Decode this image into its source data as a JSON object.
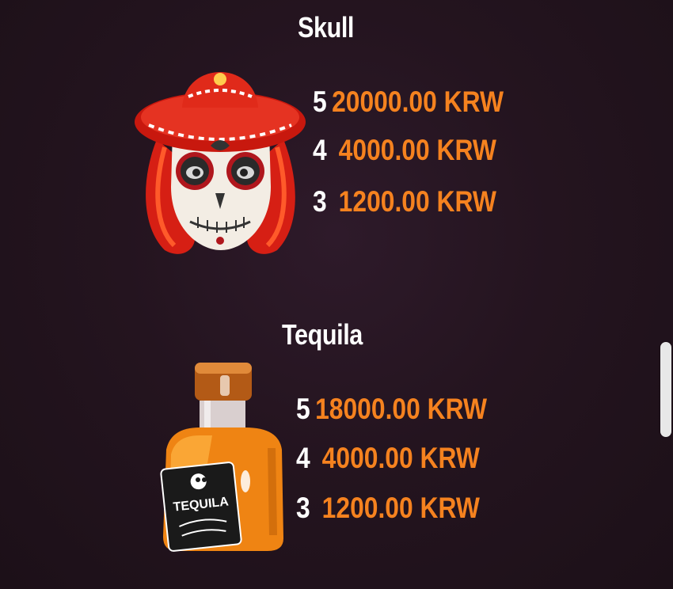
{
  "paytable": {
    "symbols": [
      {
        "name": "Skull",
        "icon": "sugar-skull-sombrero-icon",
        "pays": [
          {
            "count": "5",
            "value": "20000.00 KRW"
          },
          {
            "count": "4",
            "value": "4000.00 KRW"
          },
          {
            "count": "3",
            "value": "1200.00 KRW"
          }
        ]
      },
      {
        "name": "Tequila",
        "icon": "tequila-bottle-icon",
        "label": "TEQUILA",
        "pays": [
          {
            "count": "5",
            "value": "18000.00 KRW"
          },
          {
            "count": "4",
            "value": "4000.00 KRW"
          },
          {
            "count": "3",
            "value": "1200.00 KRW"
          }
        ]
      }
    ]
  },
  "colors": {
    "background": "#24141f",
    "title": "#ffffff",
    "count": "#ffffff",
    "value": "#f5821f"
  }
}
